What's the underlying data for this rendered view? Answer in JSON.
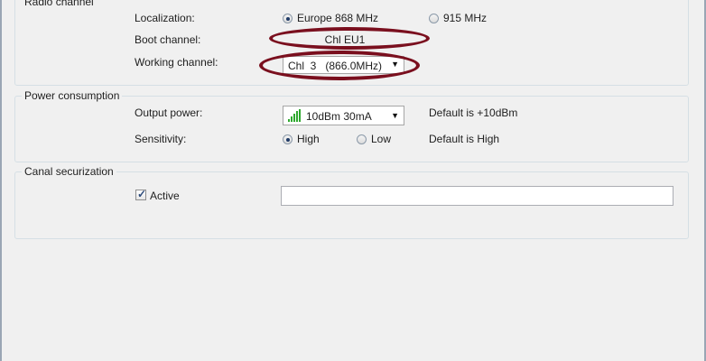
{
  "radio_channel": {
    "title": "Radio channel",
    "localization_label": "Localization:",
    "localization_options": [
      {
        "label": "Europe 868 MHz",
        "selected": true
      },
      {
        "label": "915 MHz",
        "selected": false
      }
    ],
    "boot_channel_label": "Boot channel:",
    "boot_channel_value": "Chl EU1",
    "working_channel_label": "Working channel:",
    "working_channel_value": "Chl  3   (866.0MHz)"
  },
  "power_consumption": {
    "title": "Power consumption",
    "output_power_label": "Output power:",
    "output_power_value": "10dBm 30mA",
    "output_power_default": "Default is +10dBm",
    "sensitivity_label": "Sensitivity:",
    "sensitivity_options": [
      {
        "label": "High",
        "selected": true
      },
      {
        "label": "Low",
        "selected": false
      }
    ],
    "sensitivity_default": "Default is High"
  },
  "canal_securization": {
    "title": "Canal securization",
    "active_label": "Active",
    "active_checked": true,
    "key_value": ""
  },
  "colors": {
    "highlight_ellipse": "#7a0f1e",
    "signal_green": "#2ea82e"
  }
}
